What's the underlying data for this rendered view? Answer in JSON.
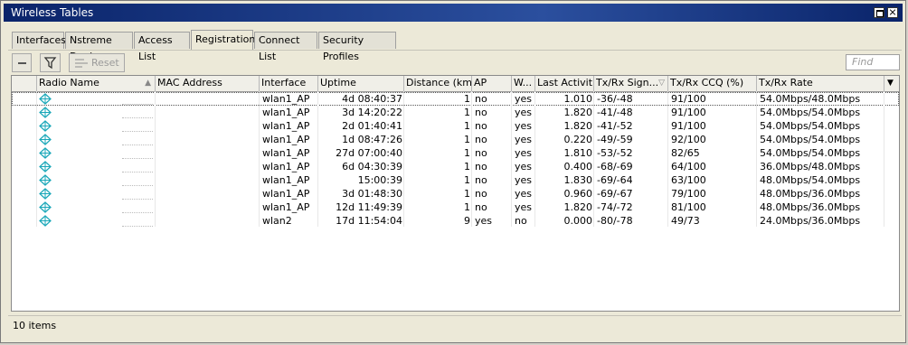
{
  "window": {
    "title": "Wireless Tables"
  },
  "tabs": [
    "Interfaces",
    "Nstreme Dual",
    "Access List",
    "Registration",
    "Connect List",
    "Security Profiles"
  ],
  "active_tab": "Registration",
  "toolbar": {
    "reset_label": "Reset",
    "find_placeholder": "Find"
  },
  "columns": [
    "Radio Name",
    "MAC Address",
    "Interface",
    "Uptime",
    "Distance (km)",
    "AP",
    "W...",
    "Last Activit...",
    "Tx/Rx Sign...",
    "Tx/Rx CCQ (%)",
    "Tx/Rx Rate"
  ],
  "rows": [
    {
      "interface": "wlan1_AP",
      "uptime": "4d 08:40:37",
      "distance": "1",
      "ap": "no",
      "w": "yes",
      "last": "1.010",
      "signal": "-36/-48",
      "ccq": "91/100",
      "rate": "54.0Mbps/48.0Mbps"
    },
    {
      "interface": "wlan1_AP",
      "uptime": "3d 14:20:22",
      "distance": "1",
      "ap": "no",
      "w": "yes",
      "last": "1.820",
      "signal": "-41/-48",
      "ccq": "91/100",
      "rate": "54.0Mbps/54.0Mbps"
    },
    {
      "interface": "wlan1_AP",
      "uptime": "2d 01:40:41",
      "distance": "1",
      "ap": "no",
      "w": "yes",
      "last": "1.820",
      "signal": "-41/-52",
      "ccq": "91/100",
      "rate": "54.0Mbps/54.0Mbps"
    },
    {
      "interface": "wlan1_AP",
      "uptime": "1d 08:47:26",
      "distance": "1",
      "ap": "no",
      "w": "yes",
      "last": "0.220",
      "signal": "-49/-59",
      "ccq": "92/100",
      "rate": "54.0Mbps/54.0Mbps"
    },
    {
      "interface": "wlan1_AP",
      "uptime": "27d 07:00:40",
      "distance": "1",
      "ap": "no",
      "w": "yes",
      "last": "1.810",
      "signal": "-53/-52",
      "ccq": "82/65",
      "rate": "54.0Mbps/54.0Mbps"
    },
    {
      "interface": "wlan1_AP",
      "uptime": "6d 04:30:39",
      "distance": "1",
      "ap": "no",
      "w": "yes",
      "last": "0.400",
      "signal": "-68/-69",
      "ccq": "64/100",
      "rate": "36.0Mbps/48.0Mbps"
    },
    {
      "interface": "wlan1_AP",
      "uptime": "15:00:39",
      "distance": "1",
      "ap": "no",
      "w": "yes",
      "last": "1.830",
      "signal": "-69/-64",
      "ccq": "63/100",
      "rate": "48.0Mbps/54.0Mbps"
    },
    {
      "interface": "wlan1_AP",
      "uptime": "3d 01:48:30",
      "distance": "1",
      "ap": "no",
      "w": "yes",
      "last": "0.960",
      "signal": "-69/-67",
      "ccq": "79/100",
      "rate": "48.0Mbps/36.0Mbps"
    },
    {
      "interface": "wlan1_AP",
      "uptime": "12d 11:49:39",
      "distance": "1",
      "ap": "no",
      "w": "yes",
      "last": "1.820",
      "signal": "-74/-72",
      "ccq": "81/100",
      "rate": "48.0Mbps/36.0Mbps"
    },
    {
      "interface": "wlan2",
      "uptime": "17d 11:54:04",
      "distance": "9",
      "ap": "yes",
      "w": "no",
      "last": "0.000",
      "signal": "-80/-78",
      "ccq": "49/73",
      "rate": "24.0Mbps/36.0Mbps"
    }
  ],
  "status": {
    "count": "10 items"
  },
  "icons": {
    "row_icon": "wireless-registration-icon",
    "filter": "filter-icon",
    "reset": "reset-icon",
    "sort": "sort-arrow-icon",
    "menu": "column-menu-icon"
  },
  "colors": {
    "titlebar": "#0a246a",
    "row_icon": "#1aa7b8"
  }
}
